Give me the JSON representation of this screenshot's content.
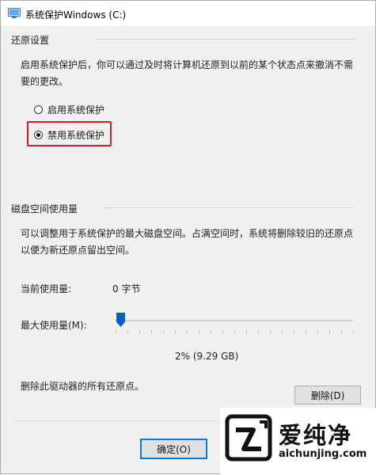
{
  "window": {
    "title": "系统保护Windows (C:)"
  },
  "restore_settings": {
    "heading": "还原设置",
    "description_line1": "启用系统保护后，你可以通过及时将计算机还原到以前的某个状态点来撤消不需",
    "description_line2": "要的更改。",
    "options": [
      {
        "label": "启用系统保护",
        "selected": false
      },
      {
        "label": "禁用系统保护",
        "selected": true
      }
    ],
    "highlight_color": "#d01d20"
  },
  "disk_usage": {
    "heading": "磁盘空间使用量",
    "description_line1": "可以调整用于系统保护的最大磁盘空间。占满空间时，系统将删除较旧的还原点",
    "description_line2": "以便为新还原点留出空间。",
    "current_usage_label": "当前使用量:",
    "current_usage_value": "0 字节",
    "max_usage_label": "最大使用量(M):",
    "max_usage_percent": 2,
    "max_usage_readout": "2% (9.29 GB)",
    "slider_color": "#0a5fc0",
    "delete_text": "删除此驱动器的所有还原点。",
    "delete_button": "删除(D)"
  },
  "footer": {
    "ok_button": "确定(O)",
    "ok_accent": "#0a78d7"
  },
  "watermark": {
    "title": "爱纯净",
    "url": "aichunjing.com",
    "icon": "aichunjing-logo-icon"
  }
}
